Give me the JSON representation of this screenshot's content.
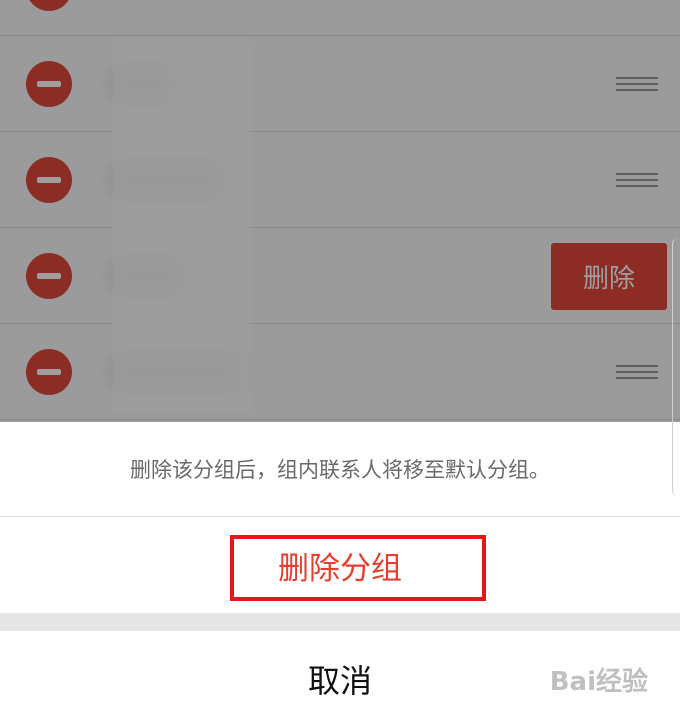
{
  "contacts": [
    {
      "name": "",
      "row": 0
    },
    {
      "name": "",
      "row": 1
    },
    {
      "name": "",
      "row": 2
    },
    {
      "name": "",
      "row": 3
    },
    {
      "name": "",
      "row": 4
    }
  ],
  "swipe_delete_label": "删除",
  "action_sheet": {
    "message": "删除该分组后，组内联系人将移至默认分组。",
    "delete_group_label": "删除分组",
    "cancel_label": "取消"
  },
  "watermark": "Bai经验",
  "colors": {
    "danger": "#e4402f",
    "highlight": "#e8151b"
  }
}
